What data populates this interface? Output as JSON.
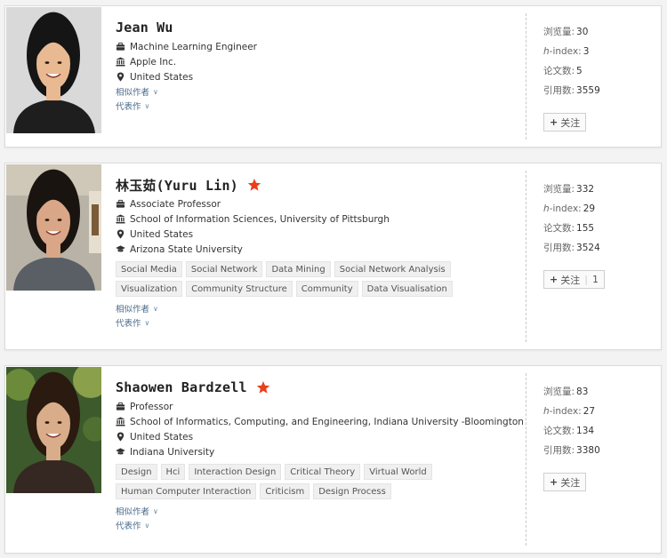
{
  "labels": {
    "views": "浏览量:",
    "h_index": "h-index:",
    "papers": "论文数:",
    "citations": "引用数:",
    "coauthors": "相似作者",
    "works": "代表作",
    "follow": "关注"
  },
  "icons": {
    "title": "briefcase-icon",
    "org": "institution-icon",
    "location": "map-pin-icon",
    "education": "graduation-cap-icon",
    "star": "star-icon"
  },
  "colors": {
    "star": "#e8401c",
    "link": "#4a6a8a"
  },
  "profiles": [
    {
      "name": "Jean Wu",
      "starred": false,
      "title": "Machine Learning Engineer",
      "org": "Apple Inc.",
      "location": "United States",
      "education": "",
      "tags": [],
      "views": "30",
      "h_index": "3",
      "papers": "5",
      "citations": "3559",
      "followers": ""
    },
    {
      "name": "林玉茹(Yuru Lin)",
      "starred": true,
      "title": "Associate Professor",
      "org": "School of Information Sciences, University of Pittsburgh",
      "location": "United States",
      "education": "Arizona State University",
      "tags": [
        "Social Media",
        "Social Network",
        "Data Mining",
        "Social Network Analysis",
        "Visualization",
        "Community Structure",
        "Community",
        "Data Visualisation"
      ],
      "views": "332",
      "h_index": "29",
      "papers": "155",
      "citations": "3524",
      "followers": "1"
    },
    {
      "name": "Shaowen Bardzell",
      "starred": true,
      "title": "Professor",
      "org": "School of Informatics, Computing, and Engineering, Indiana University -Bloomington",
      "location": "United States",
      "education": "Indiana University",
      "tags": [
        "Design",
        "Hci",
        "Interaction Design",
        "Critical Theory",
        "Virtual World",
        "Human Computer Interaction",
        "Criticism",
        "Design Process"
      ],
      "views": "83",
      "h_index": "27",
      "papers": "134",
      "citations": "3380",
      "followers": ""
    }
  ]
}
